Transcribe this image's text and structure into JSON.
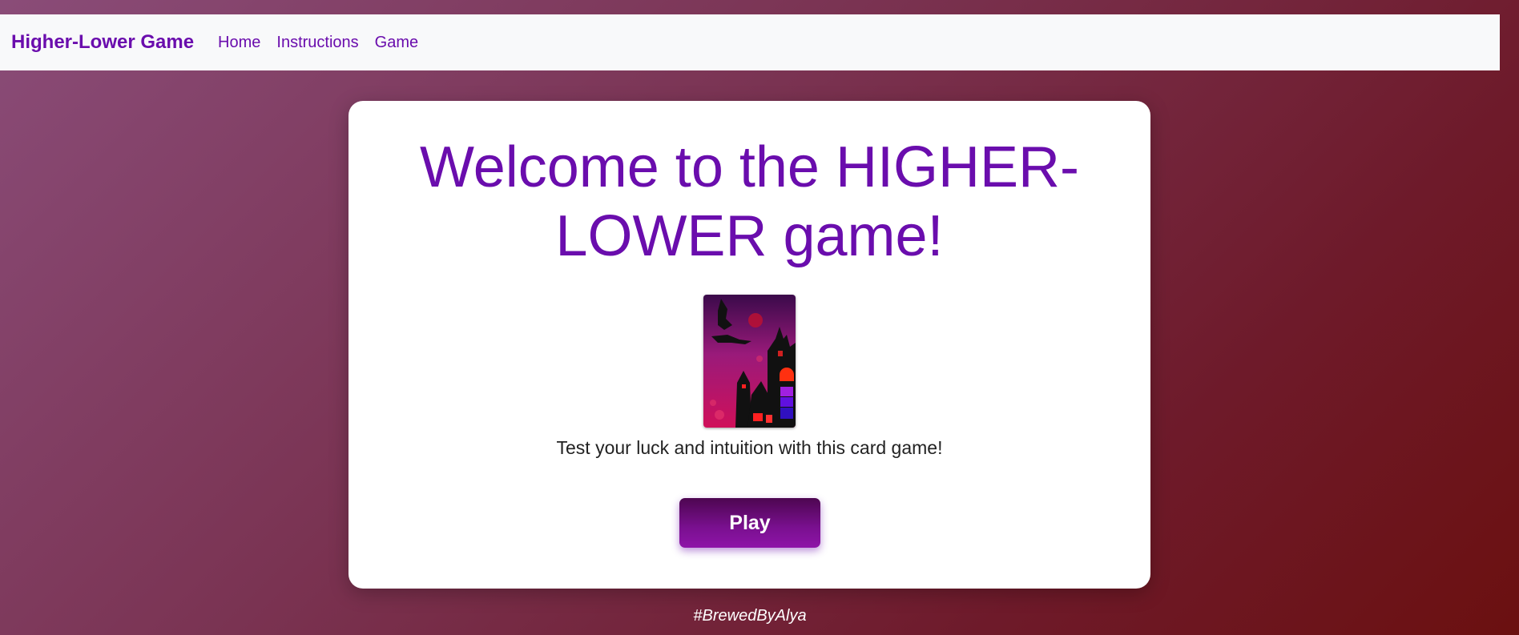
{
  "nav": {
    "brand": "Higher-Lower Game",
    "links": [
      "Home",
      "Instructions",
      "Game"
    ]
  },
  "main": {
    "title": "Welcome to the HIGHER-LOWER game!",
    "card_image": "halloween-card-back",
    "tagline": "Test your luck and intuition with this card game!",
    "play_label": "Play"
  },
  "footer": {
    "text": "#BrewedByAlya"
  },
  "colors": {
    "accent": "#6a0dad",
    "navbar_bg": "#f8f9fa",
    "card_bg": "#ffffff"
  }
}
